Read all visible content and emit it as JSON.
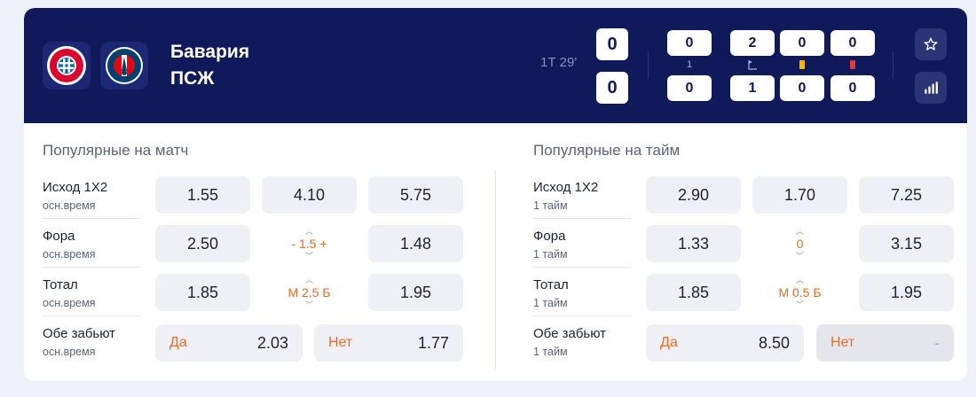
{
  "match": {
    "team_home": "Бавария",
    "team_away": "ПСЖ",
    "period": "1Т 29'",
    "score_home": "0",
    "score_away": "0"
  },
  "stats": {
    "top": [
      "0",
      "2",
      "0",
      "0"
    ],
    "labels": [
      "1",
      "corner-icon",
      "yellow-card-icon",
      "red-card-icon"
    ],
    "bottom": [
      "0",
      "1",
      "0",
      "0"
    ]
  },
  "colors": {
    "header_bg": "#10195a",
    "accent_orange": "#f06a1d",
    "yellow_card": "#f5b800",
    "red_card": "#e53935"
  },
  "match_markets": {
    "title": "Популярные на матч",
    "rows": [
      {
        "name": "Исход 1Х2",
        "sub": "осн.время",
        "odds": [
          "1.55",
          "4.10",
          "5.75"
        ]
      },
      {
        "name": "Фора",
        "sub": "осн.время",
        "odds": [
          "2.50",
          "1.48"
        ],
        "line": "- 1.5 +"
      },
      {
        "name": "Тотал",
        "sub": "осн.время",
        "odds": [
          "1.85",
          "1.95"
        ],
        "line": "М 2.5 Б"
      },
      {
        "name": "Обе забьют",
        "sub": "осн.время",
        "yes_label": "Да",
        "yes_value": "2.03",
        "no_label": "Нет",
        "no_value": "1.77"
      }
    ]
  },
  "half_markets": {
    "title": "Популярные на тайм",
    "rows": [
      {
        "name": "Исход 1Х2",
        "sub": "1 тайм",
        "odds": [
          "2.90",
          "1.70",
          "7.25"
        ]
      },
      {
        "name": "Фора",
        "sub": "1 тайм",
        "odds": [
          "1.33",
          "3.15"
        ],
        "line": "0"
      },
      {
        "name": "Тотал",
        "sub": "1 тайм",
        "odds": [
          "1.85",
          "1.95"
        ],
        "line": "М 0.5 Б"
      },
      {
        "name": "Обе забьют",
        "sub": "1 тайм",
        "yes_label": "Да",
        "yes_value": "8.50",
        "no_label": "Нет",
        "no_value": "-"
      }
    ]
  }
}
